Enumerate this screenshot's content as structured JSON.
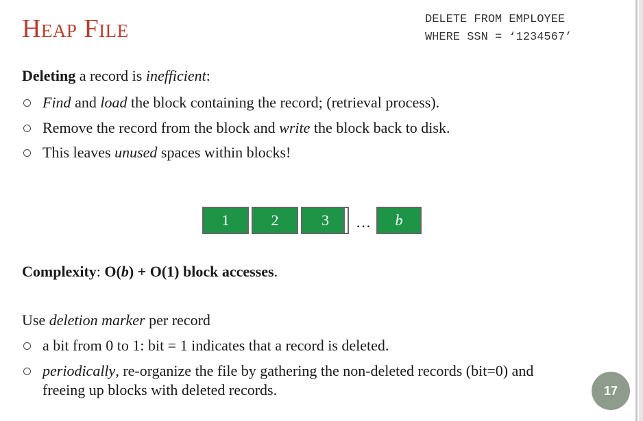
{
  "slide": {
    "title": "Heap File",
    "sql_line1": "DELETE FROM EMPLOYEE",
    "sql_line2": "WHERE SSN = ‘1234567’",
    "intro": {
      "bold": "Deleting",
      "mid": " a record is ",
      "ital": "inefficient",
      "end": ":"
    },
    "bullets1": [
      {
        "p1": "Find",
        "p2": " and ",
        "p3": "load",
        "p4": " the block containing the record; (retrieval process)."
      },
      {
        "p1": "Remove the record from the block and ",
        "p2": "write",
        "p3": " the block back to disk."
      },
      {
        "p1": "This leaves ",
        "p2": "unused",
        "p3": " spaces within blocks!"
      }
    ],
    "blocks": [
      "1",
      "2",
      "3",
      "b"
    ],
    "ellipsis": "…",
    "complexity": {
      "label": "Complexity",
      "colon": ": ",
      "expr_a": "O(",
      "expr_b": "b",
      "expr_c": ") + O(1) block accesses",
      "end": "."
    },
    "use": {
      "p1": "Use ",
      "p2": "deletion marker",
      "p3": " per record"
    },
    "bullets2": [
      {
        "p1": "a bit from 0 to 1: bit = 1 indicates that a record is deleted."
      },
      {
        "p1": "periodically",
        "p2": ", re-organize the file by gathering the non-deleted records (bit=0) and freeing up blocks with deleted records."
      }
    ],
    "page_number": "17"
  },
  "colors": {
    "title": "#b5402f",
    "block": "#1e9447",
    "badge": "#8f9c8d"
  }
}
